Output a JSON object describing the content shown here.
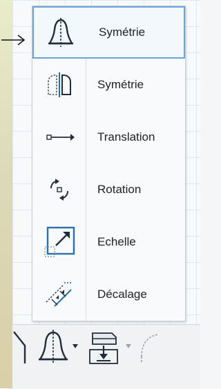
{
  "menu": {
    "items": [
      {
        "label": "Symétrie",
        "icon": "mirror-bell-icon"
      },
      {
        "label": "Symétrie",
        "icon": "mirror-copy-icon"
      },
      {
        "label": "Translation",
        "icon": "translation-arrow-icon"
      },
      {
        "label": "Rotation",
        "icon": "rotation-icon"
      },
      {
        "label": "Echelle",
        "icon": "scale-icon"
      },
      {
        "label": "Décalage",
        "icon": "offset-icon"
      }
    ]
  },
  "colors": {
    "accent": "#6aa4d8",
    "icon_dark": "#1f2d3a",
    "icon_blue": "#2a6fb0"
  }
}
